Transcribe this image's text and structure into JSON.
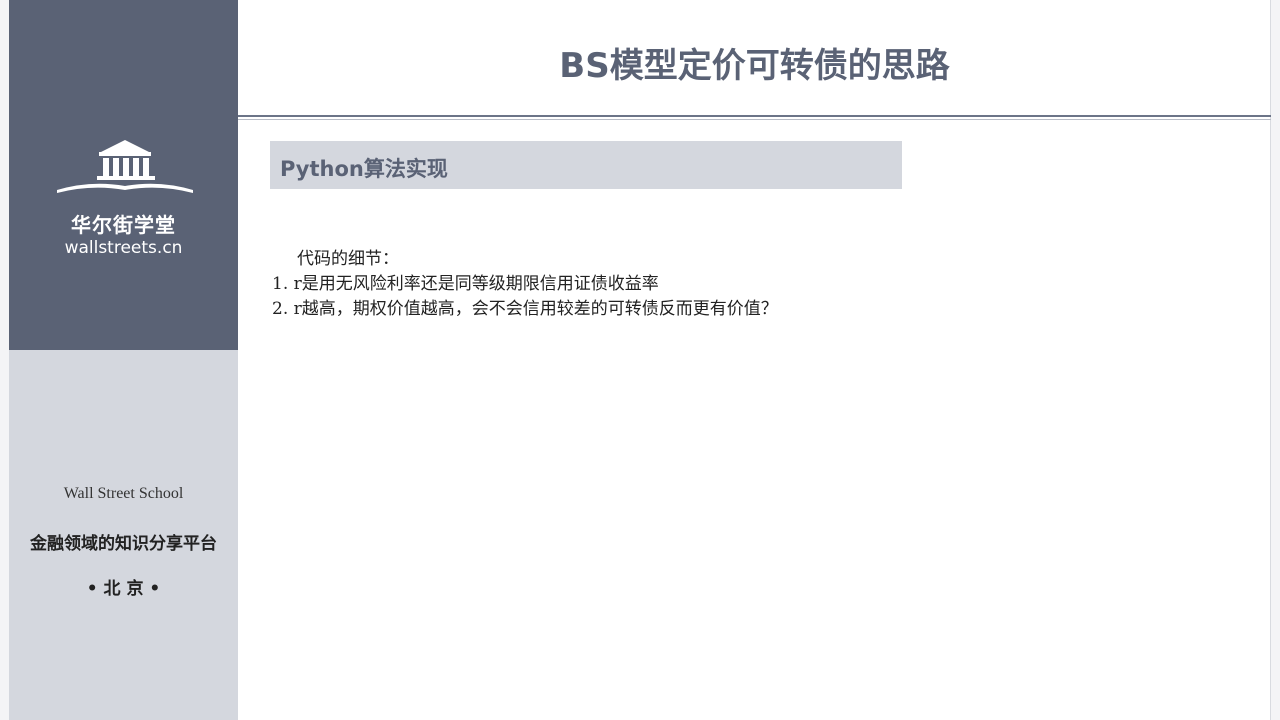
{
  "sidebar": {
    "logo_icon": "institution-building-icon",
    "brand_cn": "华尔街学堂",
    "brand_url": "wallstreets.cn",
    "school_en": "Wall Street School",
    "school_cn": "金融领域的知识分享平台",
    "city": "• 北 京 •"
  },
  "slide": {
    "title": "BS模型定价可转债的思路",
    "section_label": "Python算法实现",
    "notes": {
      "intro": "代码的细节：",
      "items": [
        "1. r是用无风险利率还是同等级期限信用证债收益率",
        "2. r越高，期权价值越高，会不会信用较差的可转债反而更有价值？"
      ]
    }
  },
  "colors": {
    "sidebar_dark": "#5a6275",
    "sidebar_light": "#d4d7de",
    "title_color": "#5a6275"
  }
}
